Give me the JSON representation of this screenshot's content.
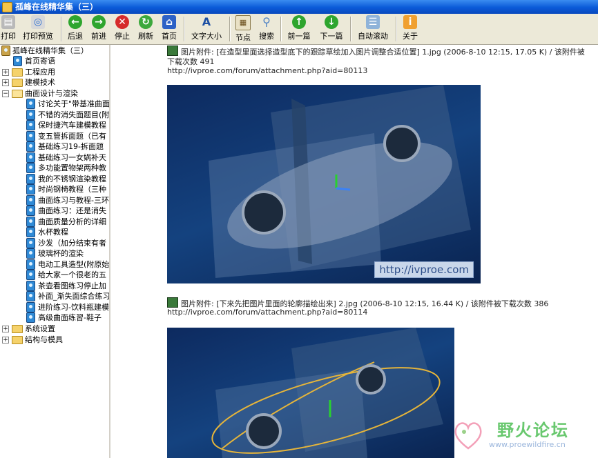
{
  "window": {
    "title": "孤峰在线精华集（三）"
  },
  "toolbar": {
    "buttons": [
      {
        "label": "打印",
        "icon": "printer-icon"
      },
      {
        "label": "打印预览",
        "icon": "print-preview-icon"
      },
      {
        "label": "后退",
        "icon": "back-arrow-icon"
      },
      {
        "label": "前进",
        "icon": "forward-arrow-icon"
      },
      {
        "label": "停止",
        "icon": "stop-icon"
      },
      {
        "label": "刷新",
        "icon": "refresh-icon"
      },
      {
        "label": "首页",
        "icon": "home-icon"
      },
      {
        "label": "文字大小",
        "icon": "font-size-icon"
      },
      {
        "label": "节点",
        "icon": "node-icon"
      },
      {
        "label": "搜索",
        "icon": "search-icon"
      },
      {
        "label": "前一篇",
        "icon": "previous-article-icon"
      },
      {
        "label": "下一篇",
        "icon": "next-article-icon"
      },
      {
        "label": "自动滚动",
        "icon": "auto-scroll-icon"
      },
      {
        "label": "关于",
        "icon": "about-icon"
      }
    ]
  },
  "tree": {
    "root": "孤峰在线精华集（三）",
    "nodes": [
      {
        "label": "首页寄语",
        "type": "doc"
      },
      {
        "label": "工程应用",
        "type": "folder",
        "expanded": false
      },
      {
        "label": "建模技术",
        "type": "folder",
        "expanded": false
      },
      {
        "label": "曲面设计与渲染",
        "type": "folder",
        "expanded": true
      },
      {
        "label": "讨论关于\"带基准曲面",
        "type": "doc"
      },
      {
        "label": "不错的消失面题目(附",
        "type": "doc"
      },
      {
        "label": "保时捷汽车建模教程",
        "type": "doc"
      },
      {
        "label": "变五管拆面题（已有",
        "type": "doc"
      },
      {
        "label": "基础练习19-拆面题",
        "type": "doc"
      },
      {
        "label": "基础练习一女娲补天",
        "type": "doc"
      },
      {
        "label": "多功能置物架两种教",
        "type": "doc"
      },
      {
        "label": "我的不锈钢渲染教程",
        "type": "doc"
      },
      {
        "label": "时尚钢椅教程（三种",
        "type": "doc"
      },
      {
        "label": "曲面练习与教程-三环",
        "type": "doc"
      },
      {
        "label": "曲面练习：还是消失",
        "type": "doc"
      },
      {
        "label": "曲面质量分析的详细",
        "type": "doc"
      },
      {
        "label": "水杯教程",
        "type": "doc"
      },
      {
        "label": "沙发（加分结束有者",
        "type": "doc"
      },
      {
        "label": "玻璃杯的渲染",
        "type": "doc"
      },
      {
        "label": "电动工具造型(附原始",
        "type": "doc"
      },
      {
        "label": "给大家一个很老的五",
        "type": "doc"
      },
      {
        "label": "茶壶看图练习停止加",
        "type": "doc"
      },
      {
        "label": "补面_渐失面综合练习",
        "type": "doc"
      },
      {
        "label": "进阶练习-饮料瓶建模",
        "type": "doc"
      },
      {
        "label": "高级曲面练習-鞋子",
        "type": "doc"
      },
      {
        "label": "系统设置",
        "type": "folder",
        "expanded": false
      },
      {
        "label": "结构与模具",
        "type": "folder",
        "expanded": false
      }
    ]
  },
  "attachments": [
    {
      "prefix": "图片附件: ",
      "name": "[在造型里面选择造型底下的跟踪草绘加入图片调整合适位置] 1.jpg",
      "meta": "(2006-8-10 12:15, 17.05 K) / 该附件被下载次数 491",
      "url": "http://ivproe.com/forum/attachment.php?aid=80113",
      "watermark": "http://ivproe.com"
    },
    {
      "prefix": "图片附件: ",
      "name": "[下来先把图片里面的轮廓描绘出来] 2.jpg",
      "meta": "(2006-8-10 12:15, 16.44 K) / 该附件被下载次数 386",
      "url": "http://ivproe.com/forum/attachment.php?aid=80114"
    }
  ],
  "forum_logo": {
    "title": "野火论坛",
    "url": "www.proewildfire.cn"
  },
  "colors": {
    "titlebar": "#0a5ad8",
    "toolbar_bg": "#ece9d8",
    "photo_bg": "#14427f"
  }
}
